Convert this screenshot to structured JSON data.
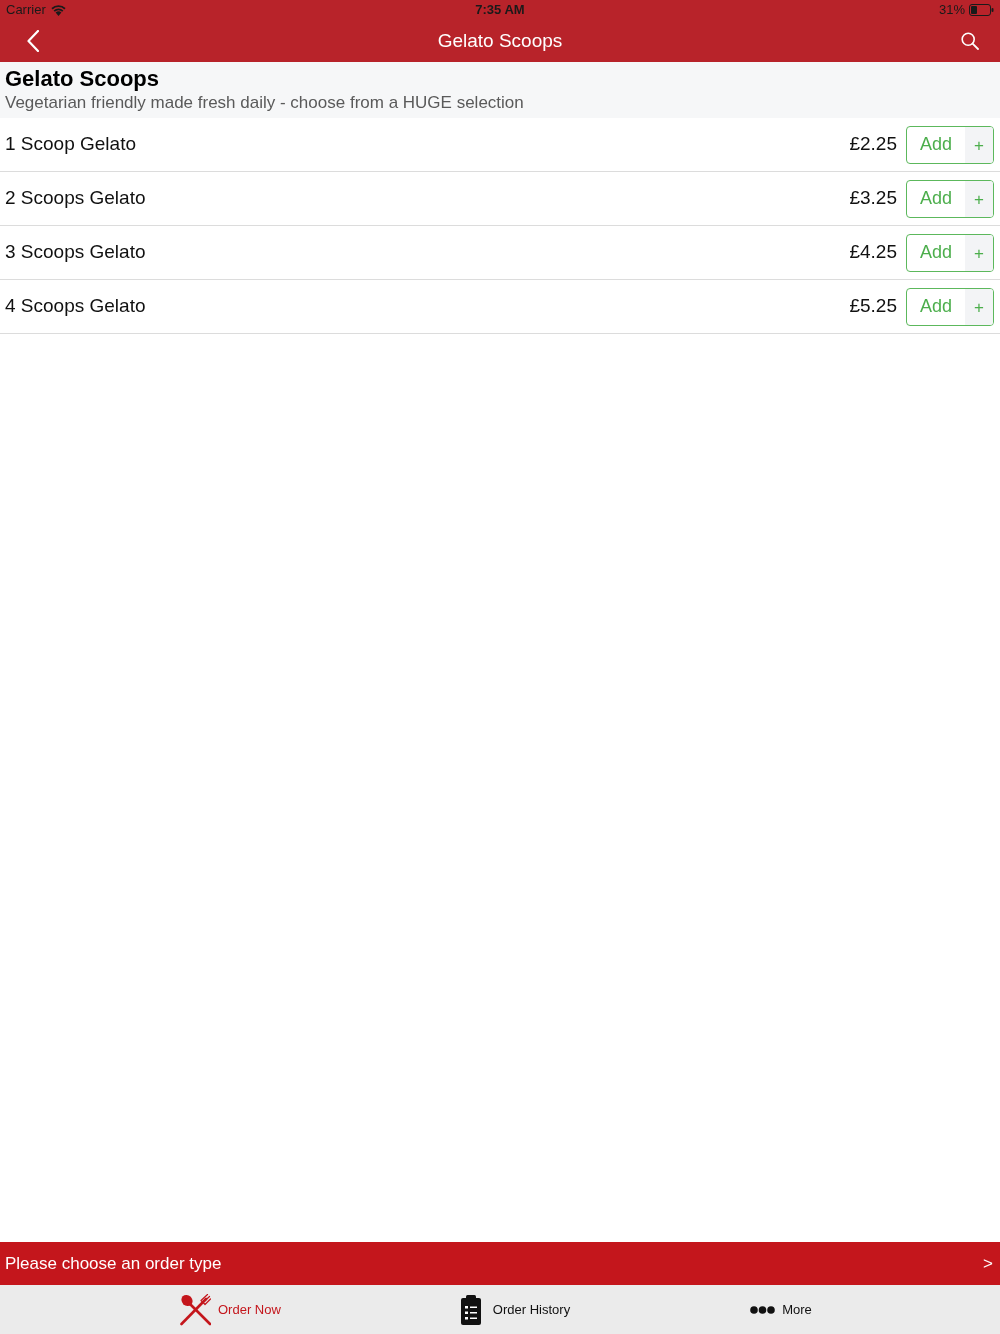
{
  "status_bar": {
    "carrier": "Carrier",
    "time": "7:35 AM",
    "battery": "31%"
  },
  "nav_bar": {
    "title": "Gelato Scoops"
  },
  "category": {
    "title": "Gelato Scoops",
    "description": "Vegetarian friendly made fresh daily - choose from a HUGE selection"
  },
  "items": [
    {
      "name": "1 Scoop Gelato",
      "price": "£2.25",
      "button": "Add",
      "plus": "+"
    },
    {
      "name": "2 Scoops Gelato",
      "price": "£3.25",
      "button": "Add",
      "plus": "+"
    },
    {
      "name": "3 Scoops Gelato",
      "price": "£4.25",
      "button": "Add",
      "plus": "+"
    },
    {
      "name": "4 Scoops Gelato",
      "price": "£5.25",
      "button": "Add",
      "plus": "+"
    }
  ],
  "order_bar": {
    "text": "Please choose an order type",
    "arrow": ">"
  },
  "tabs": [
    {
      "label": "Order Now",
      "selected": true
    },
    {
      "label": "Order History",
      "selected": false
    },
    {
      "label": "More",
      "selected": false
    }
  ]
}
